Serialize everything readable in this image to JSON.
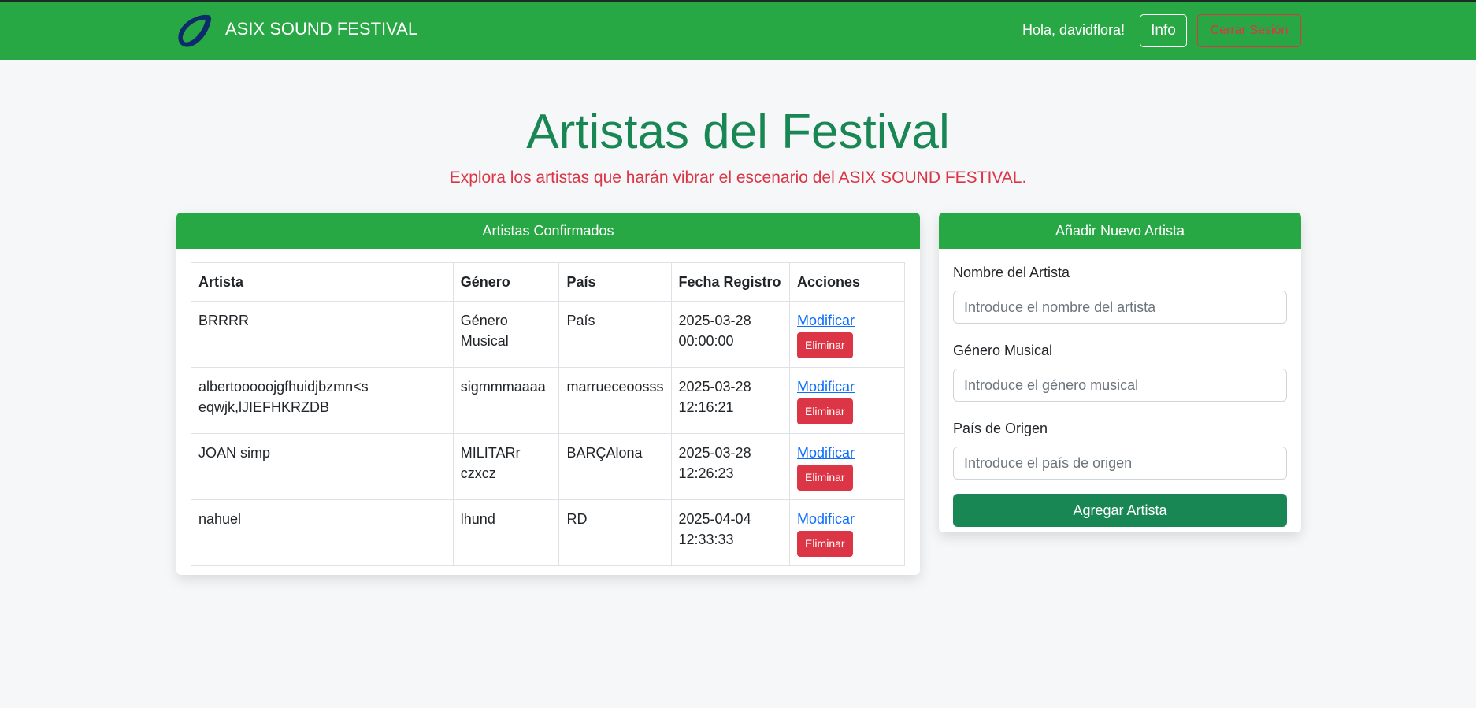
{
  "colors": {
    "navbar": "#28a745",
    "title": "#198754",
    "subtitle": "#dc3545",
    "danger": "#dc3545",
    "link": "#0d6efd",
    "submit": "#198754"
  },
  "navbar": {
    "logo_icon": "swoosh-logo-icon",
    "brand": "ASIX SOUND FESTIVAL",
    "greeting": "Hola, davidflora!",
    "info_label": "Info",
    "logout_label": "Cerrar Sesión"
  },
  "hero": {
    "title": "Artistas del Festival",
    "subtitle": "Explora los artistas que harán vibrar el escenario del ASIX SOUND FESTIVAL."
  },
  "artists_card": {
    "header": "Artistas Confirmados",
    "columns": [
      "Artista",
      "Género",
      "País",
      "Fecha Registro",
      "Acciones"
    ],
    "rows": [
      {
        "artist": "BRRRR",
        "genre": "Género Musical",
        "country": "País",
        "date": "2025-03-28 00:00:00",
        "edit": "Modificar",
        "delete": "Eliminar"
      },
      {
        "artist": "albertooooojgfhuidjbzmn<s eqwjk,lJIEFHKRZDB",
        "genre": "sigmmmaaaa",
        "country": "marrueceoosss",
        "date": "2025-03-28 12:16:21",
        "edit": "Modificar",
        "delete": "Eliminar"
      },
      {
        "artist": "JOAN simp",
        "genre": "MILITARr czxcz",
        "country": "BARÇAlona",
        "date": "2025-03-28 12:26:23",
        "edit": "Modificar",
        "delete": "Eliminar"
      },
      {
        "artist": "nahuel",
        "genre": "lhund",
        "country": "RD",
        "date": "2025-04-04 12:33:33",
        "edit": "Modificar",
        "delete": "Eliminar"
      }
    ]
  },
  "form_card": {
    "header": "Añadir Nuevo Artista",
    "name_label": "Nombre del Artista",
    "name_placeholder": "Introduce el nombre del artista",
    "name_value": "",
    "genre_label": "Género Musical",
    "genre_placeholder": "Introduce el género musical",
    "genre_value": "",
    "country_label": "País de Origen",
    "country_placeholder": "Introduce el país de origen",
    "country_value": "",
    "submit_label": "Agregar Artista"
  }
}
